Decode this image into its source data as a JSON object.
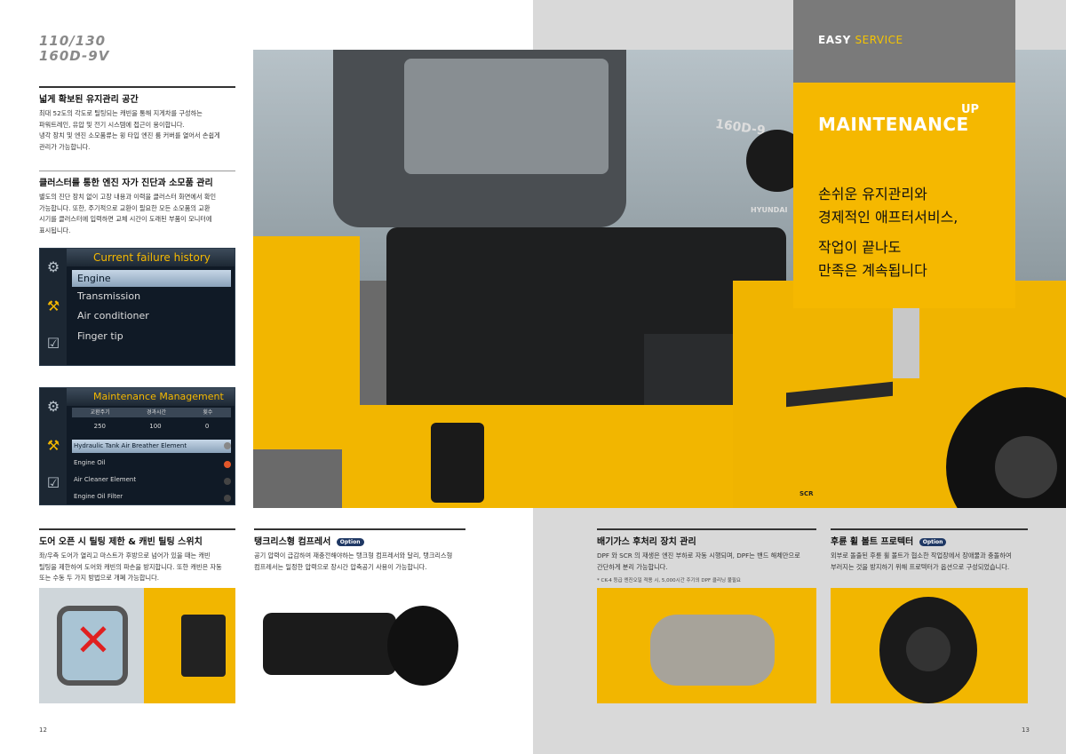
{
  "model": {
    "line1": "110/130",
    "line2": "160D-9V"
  },
  "left_sections": [
    {
      "title": "넓게 확보된 유지관리 공간",
      "lines": [
        "최대 52도의 각도로 틸팅되는 캐빈을 통해 지게차를 구성하는",
        "파워트레인, 유압 및 전기 시스템에 접근이 용이합니다.",
        "냉각 장치 및 엔진 소모품류는 윙 타입 엔진 룸 커버를 열어서 손쉽게",
        "관리가 가능합니다."
      ]
    },
    {
      "title": "클러스터를 통한 엔진 자가 진단과 소모품 관리",
      "lines": [
        "별도의 진단 장치 없이 고장 내용과 이력을 클러스터 화면에서 확인",
        "가능합니다. 또한, 주기적으로 교환이 필요한 모든 소모품의 교환",
        "시기를 클러스터에 입력하면 교체 시간이 도래된 부품이 모니터에",
        "표시됩니다."
      ]
    }
  ],
  "failure_screen": {
    "header": "Current failure history",
    "items": [
      "Engine",
      "Transmission",
      "Air conditioner",
      "Finger tip"
    ]
  },
  "maint_screen": {
    "header": "Maintenance Management",
    "cols": [
      "교환주기",
      "경과시간",
      "횟수"
    ],
    "vals": [
      "250",
      "100",
      "0"
    ],
    "items": [
      "Hydraulic Tank Air Breather Element",
      "Engine Oil",
      "Air Cleaner Element",
      "Engine Oil Filter"
    ]
  },
  "easy_service": {
    "bold": "EASY",
    "light": "SERVICE"
  },
  "maintenance": {
    "main": "MAINTENANCE",
    "up": "UP"
  },
  "slogan": {
    "l1": "손쉬운 유지관리와",
    "l2": "경제적인 애프터서비스,",
    "l3": "작업이 끝나도",
    "l4": "만족은 계속됩니다"
  },
  "bottom": [
    {
      "title": "도어 오픈 시 틸팅 제한 & 캐빈 틸팅 스위치",
      "badge": "",
      "lines": [
        "좌/우측 도어가 열리고 마스트가 후방으로 넘어가 있을 때는 캐빈",
        "틸팅을 제한하여 도어와 캐빈의 파손을 방지합니다. 또한 캐빈은 자동",
        "또는 수동 두 가지 방법으로 개폐 가능합니다."
      ]
    },
    {
      "title": "탱크리스형 컴프레서",
      "badge": "Option",
      "lines": [
        "공기 압력이 급감하여 재충전해야하는 탱크형 컴프레서와 달리, 탱크리스형",
        "컴프레서는 일정한 압력으로 장시간 압축공기 사용이 가능합니다."
      ]
    },
    {
      "title": "배기가스 후처리 장치 관리",
      "badge": "",
      "lines": [
        "DPF 와 SCR 의 재생은 엔진 부하로 자동 시행되며, DPF는 밴드 해체만으로",
        "간단하게 분리 가능합니다."
      ],
      "note": "* CK-4 등급 엔진오일 적용 시, 5,000시간 주기의 DPF 클리닝 불필요"
    },
    {
      "title": "후륜 휠 볼트 프로텍터",
      "badge": "Option",
      "lines": [
        "외부로 돌출된 후륜 휠 볼트가 협소한 작업장에서 장애물과 충돌하여",
        "부러지는 것을 방지하기 위해 프로텍터가 옵션으로 구성되었습니다."
      ]
    }
  ],
  "hero_texts": {
    "decal": "160D-9",
    "brand": "HYUNDAI",
    "scr": "SCR"
  },
  "pages": {
    "left": "12",
    "right": "13"
  }
}
